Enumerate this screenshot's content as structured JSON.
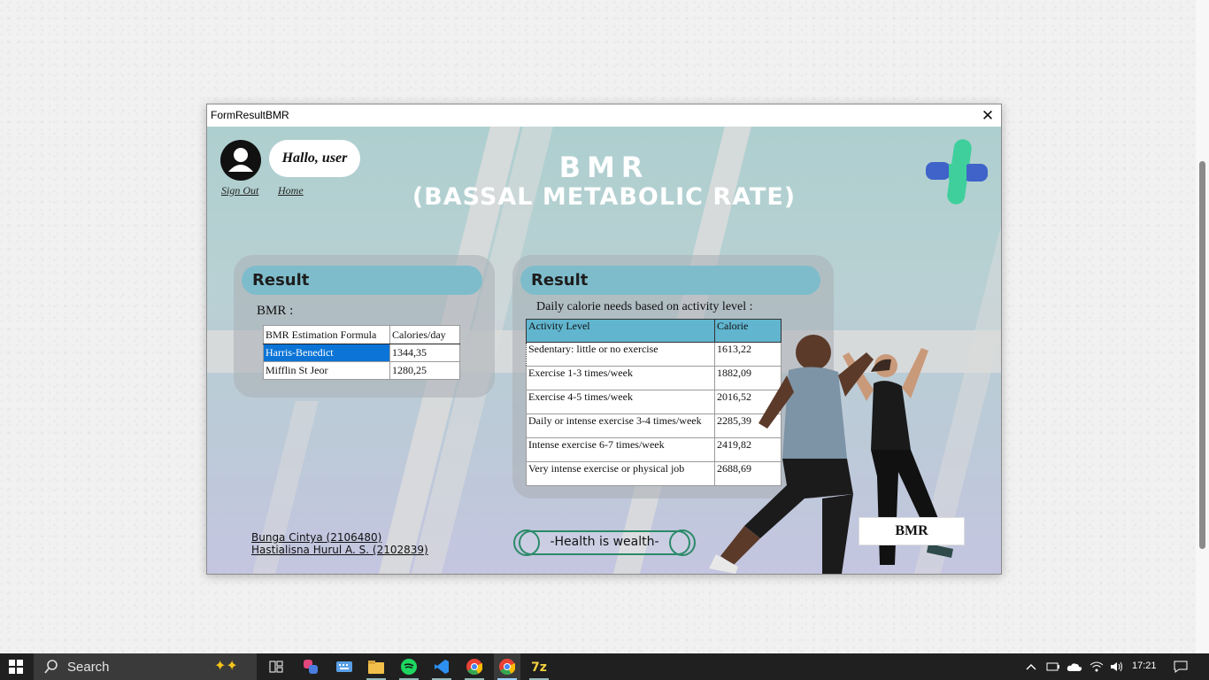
{
  "window": {
    "title": "FormResultBMR",
    "close_symbol": "✕"
  },
  "header": {
    "greeting": "Hallo, user",
    "sign_out": "Sign Out",
    "home": "Home",
    "title_line1": "BMR",
    "title_line2": "(BASSAL METABOLIC RATE)"
  },
  "bmr_panel": {
    "heading": "Result",
    "label": "BMR :",
    "columns": [
      "BMR Estimation Formula",
      "Calories/day"
    ],
    "rows": [
      {
        "formula": "Harris-Benedict",
        "calories": "1344,35"
      },
      {
        "formula": "Mifflin St Jeor",
        "calories": "1280,25"
      }
    ]
  },
  "activity_panel": {
    "heading": "Result",
    "label": "Daily calorie needs based on activity level :",
    "columns": [
      "Activity Level",
      "Calorie"
    ],
    "rows": [
      {
        "level": "Sedentary: little or no exercise",
        "calorie": "1613,22"
      },
      {
        "level": "Exercise 1-3 times/week",
        "calorie": "1882,09"
      },
      {
        "level": "Exercise 4-5 times/week",
        "calorie": "2016,52"
      },
      {
        "level": "Daily or intense exercise 3-4 times/week",
        "calorie": "2285,39"
      },
      {
        "level": "Intense exercise 6-7 times/week",
        "calorie": "2419,82"
      },
      {
        "level": "Very intense exercise or physical job",
        "calorie": "2688,69"
      }
    ]
  },
  "footer": {
    "author1": "Bunga Cintya (2106480)",
    "author2": "Hastialisna Hurul A. S. (2102839)",
    "slogan": "-Health is wealth-",
    "bmr_button": "BMR"
  },
  "taskbar": {
    "search_label": "Search",
    "time": "17:21",
    "apps": [
      "start-icon",
      "search-icon",
      "task-view-icon",
      "copilot-icon",
      "keyboard-icon",
      "file-explorer-icon",
      "spotify-icon",
      "vscode-icon",
      "chrome-icon",
      "chrome-icon",
      "7zip-icon"
    ]
  },
  "colors": {
    "panel_header": "#7ebccb",
    "selection": "#0b74d6",
    "accent_green": "#2b8a68",
    "logo_green": "#3fcf9c",
    "logo_blue": "#3f63c9"
  }
}
